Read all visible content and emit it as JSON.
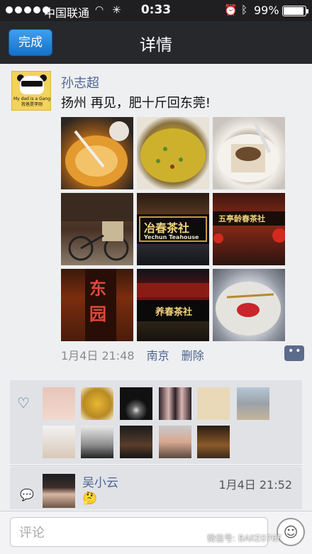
{
  "status_bar": {
    "carrier": "中国联通",
    "time": "0:33",
    "battery": "99%",
    "battery_level": 0.99
  },
  "nav": {
    "done_label": "完成",
    "title": "详情"
  },
  "post": {
    "avatar_caption_line1": "My dad is a Gang",
    "avatar_caption_line2": "我爸是李刚",
    "author": "孙志超",
    "text": "扬州 再见，肥十斤回东莞!",
    "photo_signs": [
      "冶春茶社",
      "Yechun Teahouse",
      "五亭龄春茶社",
      "东园",
      "养春茶社"
    ],
    "date": "1月4日 21:48",
    "location": "南京",
    "delete_label": "删除"
  },
  "likes": {
    "count_shown": 11
  },
  "comments": [
    {
      "author": "吴小云",
      "time": "1月4日 21:52",
      "content": "🤔"
    }
  ],
  "input": {
    "placeholder": "评论"
  },
  "watermark": "微信号: BAKE076F",
  "icons": {
    "heart": "heart-icon",
    "comment": "comment-icon",
    "emoji": "smiley-icon",
    "wifi": "wifi-icon",
    "alarm": "alarm-icon",
    "bluetooth": "bluetooth-icon"
  }
}
